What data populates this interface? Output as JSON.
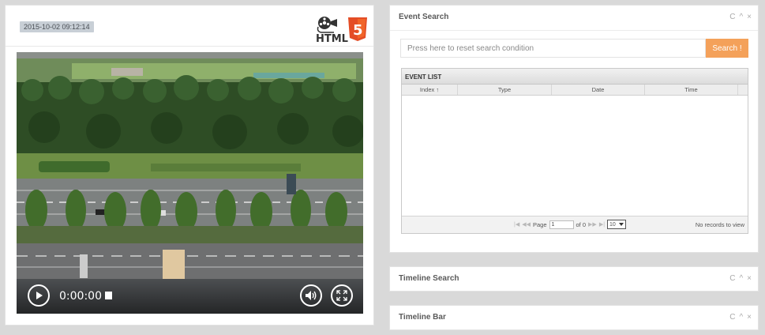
{
  "player": {
    "timestamp": "2015-10-02 09:12:14",
    "logo_text": "HTML",
    "logo_badge": "5",
    "current_time": "0:00:00"
  },
  "event_search": {
    "title": "Event Search",
    "tools": {
      "refresh": "C",
      "collapse": "^",
      "close": "×"
    },
    "search_placeholder": "Press here to reset search condition",
    "search_button": "Search !",
    "grid": {
      "caption": "EVENT LIST",
      "columns": [
        "Index ↑",
        "Type",
        "Date",
        "Time"
      ],
      "rows": [],
      "pager": {
        "first": "|◀",
        "prev": "◀◀",
        "page_label": "Page",
        "page_value": "1",
        "of_label": "of 0",
        "next": "▶▶",
        "last": "▶|",
        "page_size": "10",
        "records_text": "No records to view"
      }
    }
  },
  "timeline_search": {
    "title": "Timeline Search",
    "tools": {
      "refresh": "C",
      "collapse": "^",
      "close": "×"
    }
  },
  "timeline_bar": {
    "title": "Timeline Bar",
    "tools": {
      "refresh": "C",
      "collapse": "^",
      "close": "×"
    }
  },
  "colors": {
    "accent": "#f4a15a",
    "html5_orange": "#e44d26",
    "badge_bg": "#c8cfd6"
  },
  "icons": [
    "play-icon",
    "volume-icon",
    "fullscreen-icon",
    "refresh-icon",
    "collapse-icon",
    "close-icon",
    "html5-logo",
    "film-reel-icon"
  ]
}
